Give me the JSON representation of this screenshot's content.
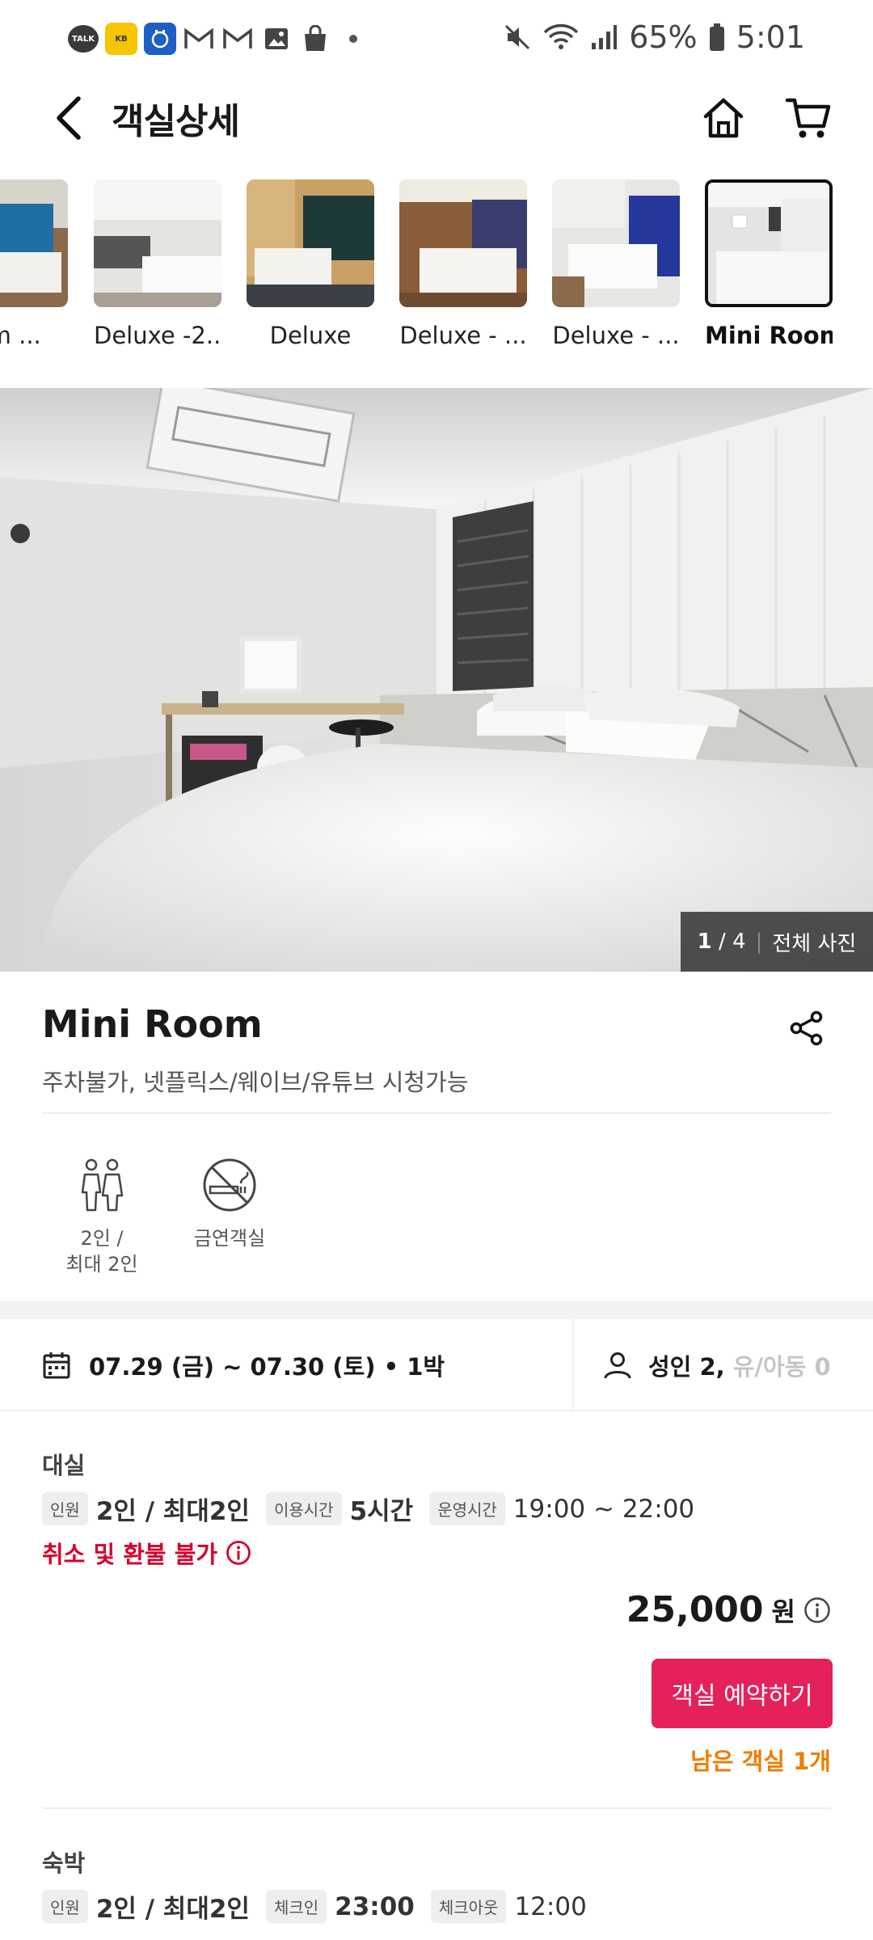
{
  "status_bar": {
    "notification_icons": [
      "talk-icon",
      "kb-pay-icon",
      "calendar-app-icon",
      "gmail-icon",
      "gmail-icon",
      "gallery-icon",
      "shopping-bag-icon",
      "dot-icon"
    ],
    "talk_label": "TALK",
    "kb_label": "KB",
    "battery": "65%",
    "time": "5:01"
  },
  "header": {
    "title": "객실상세"
  },
  "thumbnails": [
    {
      "label": "ium ...",
      "active": false
    },
    {
      "label": "Deluxe -2...",
      "active": false
    },
    {
      "label": "Deluxe",
      "active": false
    },
    {
      "label": "Deluxe - ...",
      "active": false
    },
    {
      "label": "Deluxe - ...",
      "active": false
    },
    {
      "label": "Mini Room",
      "active": true
    }
  ],
  "photo": {
    "current": "1",
    "total": "4",
    "all_photos_label": "전체 사진"
  },
  "room": {
    "name": "Mini Room",
    "description": "주차불가, 넷플릭스/웨이브/유튜브 시청가능",
    "amenities": [
      {
        "icon": "two-people-icon",
        "line1": "2인 /",
        "line2": "최대 2인"
      },
      {
        "icon": "no-smoking-icon",
        "line1": "금연객실",
        "line2": ""
      }
    ]
  },
  "booking": {
    "dates": "07.29 (금) ~ 07.30 (토) • 1박",
    "adults": "성인 2,",
    "children": "유/아동 0"
  },
  "offers": [
    {
      "title": "대실",
      "tags": [
        {
          "tag": "인원",
          "value": "2인 / 최대2인"
        },
        {
          "tag": "이용시간",
          "value": "5시간"
        },
        {
          "tag": "운영시간",
          "value": "19:00 ~ 22:00"
        }
      ],
      "cancel_note": "취소 및 환불 불가",
      "price": "25,000",
      "currency": "원",
      "reserve_label": "객실 예약하기",
      "remaining": "남은 객실 1개"
    },
    {
      "title": "숙박",
      "tags": [
        {
          "tag": "인원",
          "value": "2인 / 최대2인"
        },
        {
          "tag": "체크인",
          "value": "23:00"
        },
        {
          "tag": "체크아웃",
          "value": "12:00"
        }
      ]
    }
  ],
  "colors": {
    "accent": "#e5215b",
    "cancel_red": "#d6002a",
    "remaining_orange": "#ef7d00"
  }
}
